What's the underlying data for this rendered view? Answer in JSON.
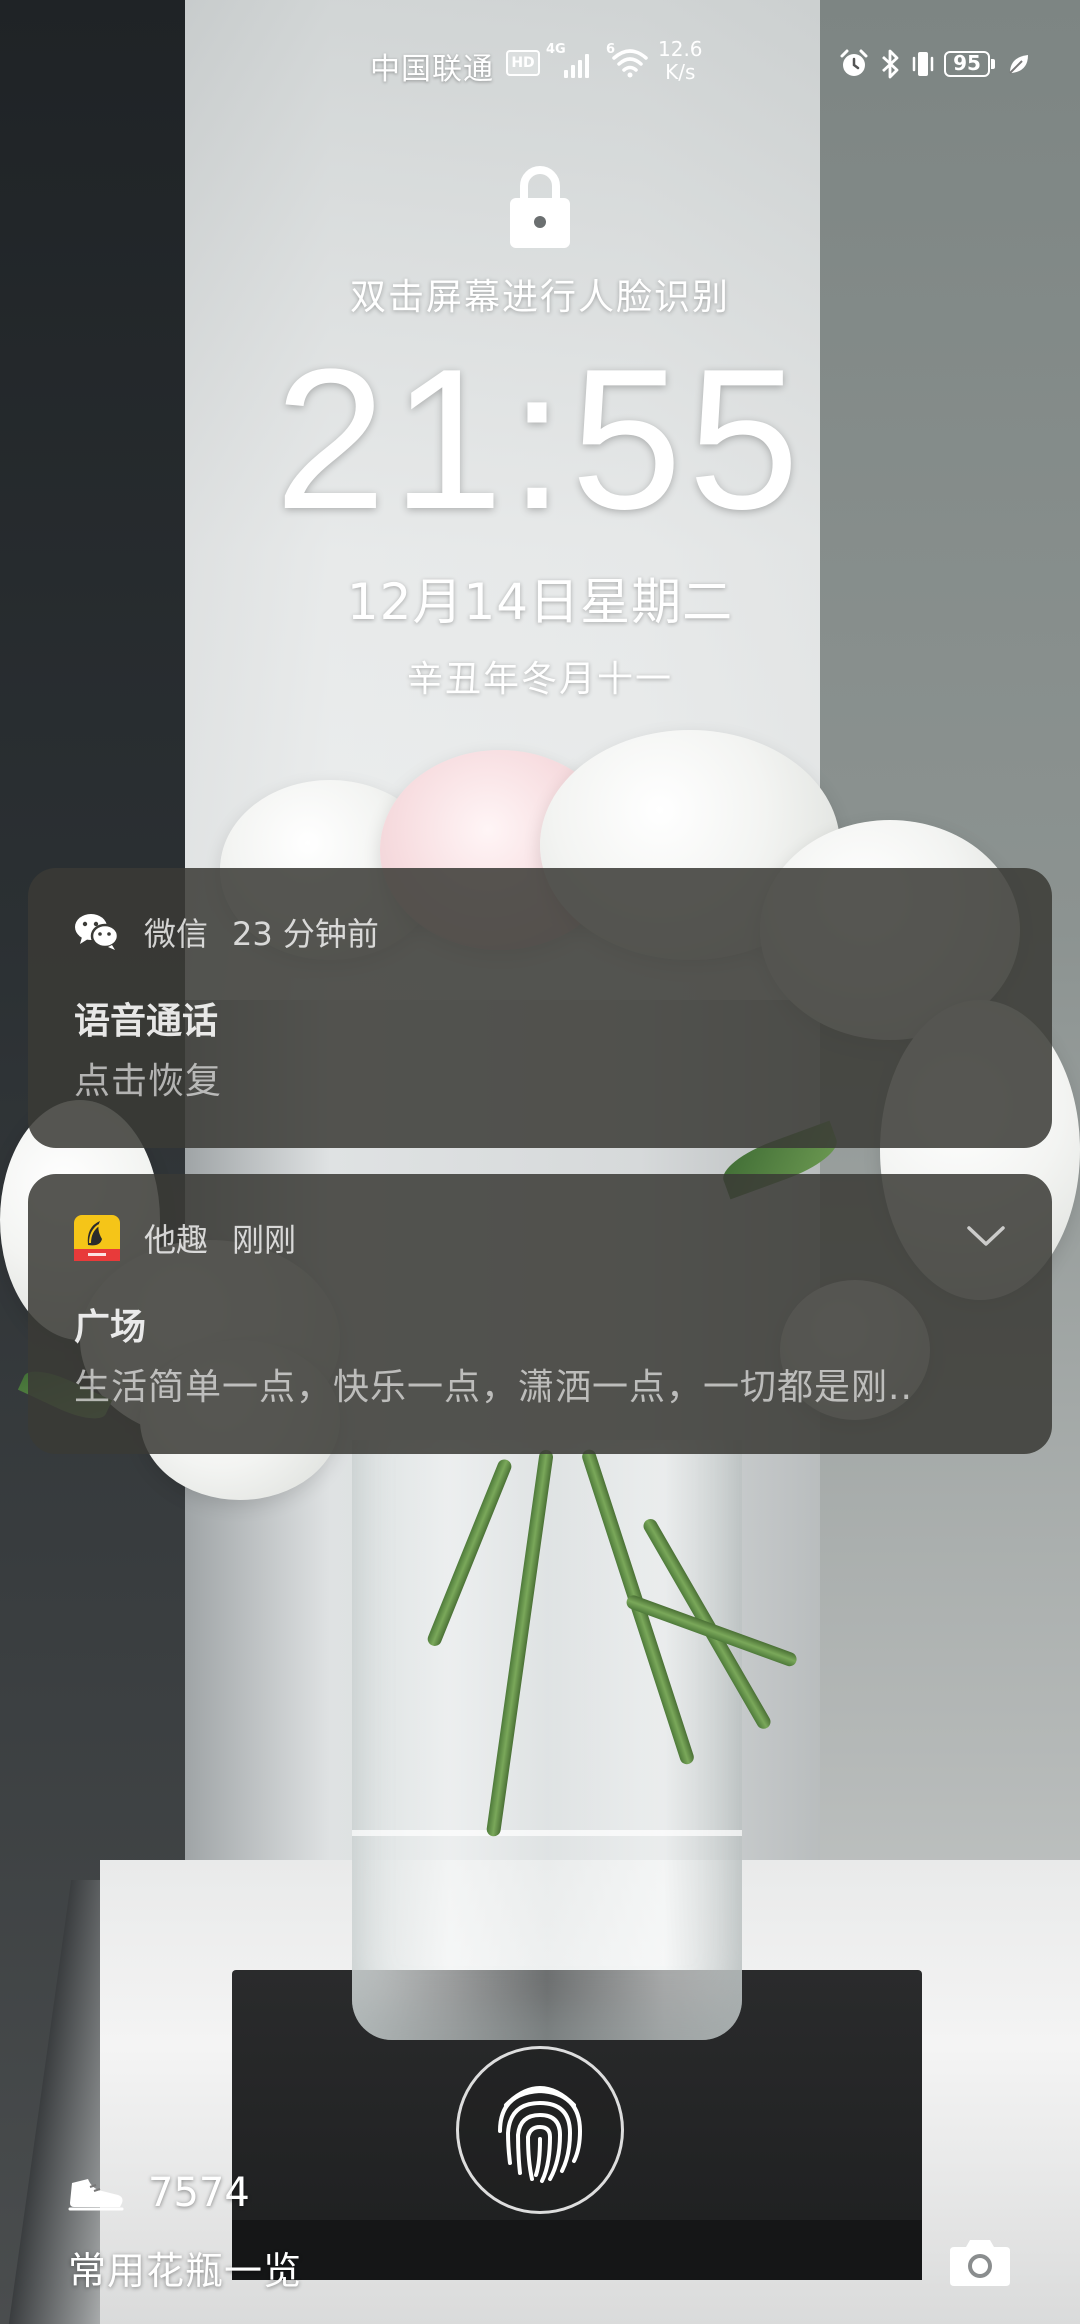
{
  "status_bar": {
    "carrier": "中国联通",
    "hd_badge": "HD",
    "signal_type": "4G",
    "wifi_type": "6",
    "net_speed_value": "12.6",
    "net_speed_unit": "K/s",
    "battery_percent": "95",
    "icons": [
      "alarm-icon",
      "bluetooth-icon",
      "vibrate-icon",
      "battery-icon",
      "power-saving-leaf-icon"
    ]
  },
  "lock_screen": {
    "unlock_hint": "双击屏幕进行人脸识别",
    "time": "21:55",
    "date": "12月14日星期二",
    "lunar_date": "辛丑年冬月十一"
  },
  "notifications": [
    {
      "app": "微信",
      "time": "23 分钟前",
      "title": "语音通话",
      "body": "点击恢复",
      "icon": "wechat-icon"
    },
    {
      "app": "他趣",
      "time": "刚刚",
      "title": "广场",
      "body": "生活简单一点，快乐一点，潇洒一点，一切都是刚..",
      "icon": "taqu-app-icon",
      "expand_icon": "chevron-down-icon"
    }
  ],
  "bottom": {
    "step_count": "7574",
    "magazine_caption": "常用花瓶一览",
    "icons": [
      "fingerprint-icon",
      "shoe-icon",
      "camera-icon"
    ]
  },
  "colors": {
    "notification_bg": "#3a3a36",
    "text_primary": "#ffffff",
    "taqu_icon_yellow": "#f5c518",
    "taqu_icon_red": "#e83a3a"
  }
}
